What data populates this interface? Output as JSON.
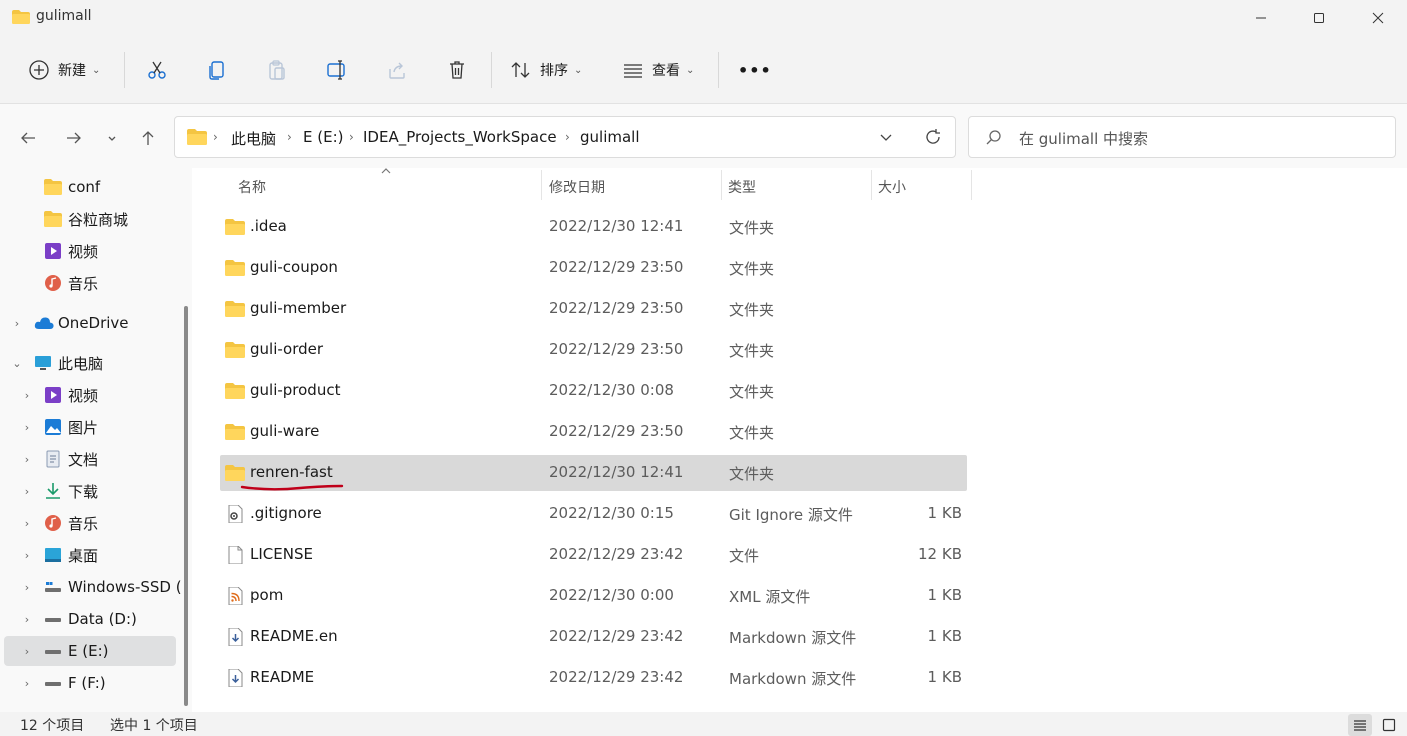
{
  "window": {
    "title": "gulimall"
  },
  "toolbar": {
    "new_label": "新建",
    "sort_label": "排序",
    "view_label": "查看",
    "more_label": "•••"
  },
  "address": {
    "crumbs": [
      "此电脑",
      "E (E:)",
      "IDEA_Projects_WorkSpace",
      "gulimall"
    ]
  },
  "search": {
    "placeholder": "在 gulimall 中搜索"
  },
  "sidebar": {
    "items": [
      {
        "label": "conf",
        "icon": "folder-icon"
      },
      {
        "label": "谷粒商城",
        "icon": "folder-icon"
      },
      {
        "label": "视频",
        "icon": "video-icon"
      },
      {
        "label": "音乐",
        "icon": "music-icon"
      },
      {
        "label": "OneDrive",
        "icon": "cloud-icon"
      },
      {
        "label": "此电脑",
        "icon": "computer-icon"
      },
      {
        "label": "视频",
        "icon": "video-icon"
      },
      {
        "label": "图片",
        "icon": "picture-icon"
      },
      {
        "label": "文档",
        "icon": "document-icon"
      },
      {
        "label": "下载",
        "icon": "download-icon"
      },
      {
        "label": "音乐",
        "icon": "music-icon"
      },
      {
        "label": "桌面",
        "icon": "desktop-icon"
      },
      {
        "label": "Windows-SSD (",
        "icon": "drive-icon"
      },
      {
        "label": "Data (D:)",
        "icon": "drive-icon"
      },
      {
        "label": "E (E:)",
        "icon": "drive-icon"
      },
      {
        "label": "F (F:)",
        "icon": "drive-icon"
      }
    ]
  },
  "columns": {
    "name": "名称",
    "date": "修改日期",
    "type": "类型",
    "size": "大小"
  },
  "files": [
    {
      "name": ".idea",
      "date": "2022/12/30 12:41",
      "type": "文件夹",
      "size": "",
      "icon": "folder-icon"
    },
    {
      "name": "guli-coupon",
      "date": "2022/12/29 23:50",
      "type": "文件夹",
      "size": "",
      "icon": "folder-icon"
    },
    {
      "name": "guli-member",
      "date": "2022/12/29 23:50",
      "type": "文件夹",
      "size": "",
      "icon": "folder-icon"
    },
    {
      "name": "guli-order",
      "date": "2022/12/29 23:50",
      "type": "文件夹",
      "size": "",
      "icon": "folder-icon"
    },
    {
      "name": "guli-product",
      "date": "2022/12/30 0:08",
      "type": "文件夹",
      "size": "",
      "icon": "folder-icon"
    },
    {
      "name": "guli-ware",
      "date": "2022/12/29 23:50",
      "type": "文件夹",
      "size": "",
      "icon": "folder-icon"
    },
    {
      "name": "renren-fast",
      "date": "2022/12/30 12:41",
      "type": "文件夹",
      "size": "",
      "icon": "folder-icon"
    },
    {
      "name": ".gitignore",
      "date": "2022/12/30 0:15",
      "type": "Git Ignore 源文件",
      "size": "1 KB",
      "icon": "settings-file-icon"
    },
    {
      "name": "LICENSE",
      "date": "2022/12/29 23:42",
      "type": "文件",
      "size": "12 KB",
      "icon": "file-icon"
    },
    {
      "name": "pom",
      "date": "2022/12/30 0:00",
      "type": "XML 源文件",
      "size": "1 KB",
      "icon": "rss-file-icon"
    },
    {
      "name": "README.en",
      "date": "2022/12/29 23:42",
      "type": "Markdown 源文件",
      "size": "1 KB",
      "icon": "markdown-file-icon"
    },
    {
      "name": "README",
      "date": "2022/12/29 23:42",
      "type": "Markdown 源文件",
      "size": "1 KB",
      "icon": "markdown-file-icon"
    }
  ],
  "status": {
    "count": "12 个项目",
    "selected": "选中 1 个项目"
  },
  "colors": {
    "folder": "#f4c542",
    "selection": "#d9d9d9",
    "annotation": "#c0001a"
  }
}
